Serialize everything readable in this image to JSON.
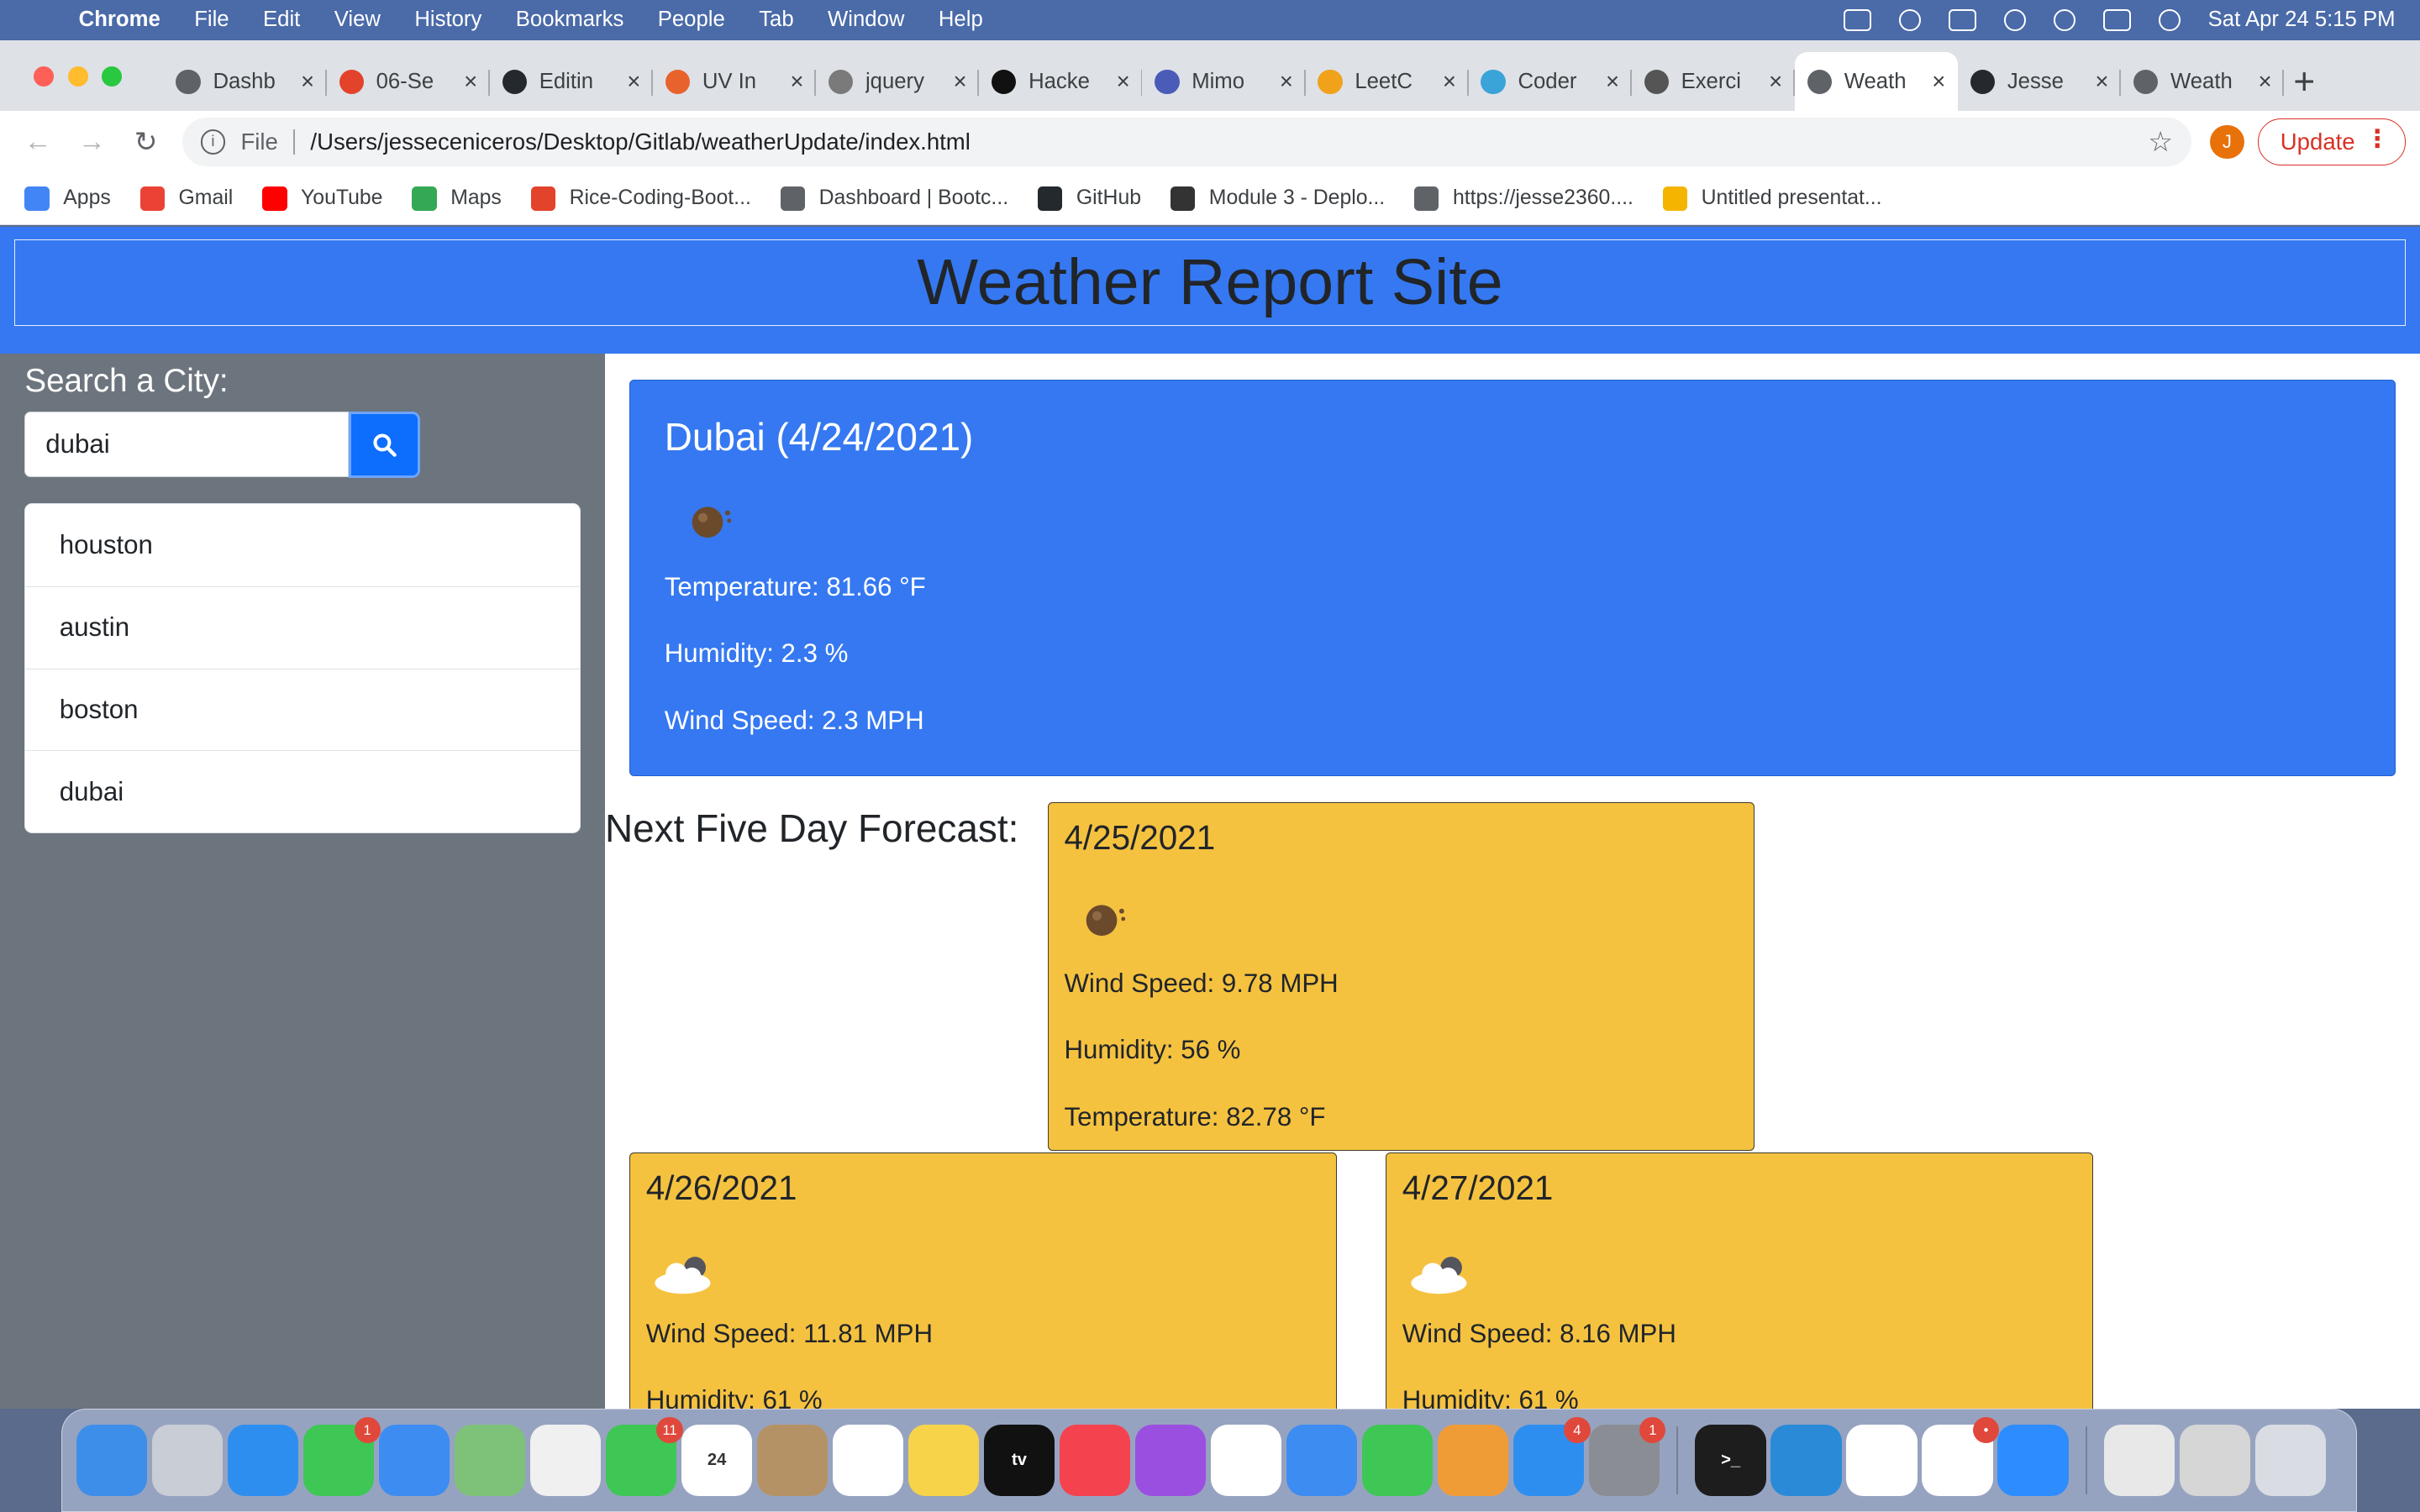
{
  "menubar": {
    "items": [
      "Chrome",
      "File",
      "Edit",
      "View",
      "History",
      "Bookmarks",
      "People",
      "Tab",
      "Window",
      "Help"
    ],
    "clock": "Sat Apr 24  5:15 PM"
  },
  "tabs": [
    {
      "title": "Dashb",
      "color": "#5f6368"
    },
    {
      "title": "06-Se",
      "color": "#e2432a"
    },
    {
      "title": "Editin",
      "color": "#24292e"
    },
    {
      "title": "UV In",
      "color": "#e8622c"
    },
    {
      "title": "jquery",
      "color": "#7a7a7a"
    },
    {
      "title": "Hacke",
      "color": "#111111"
    },
    {
      "title": "Mimo",
      "color": "#4b5bb8"
    },
    {
      "title": "LeetC",
      "color": "#f0a21b"
    },
    {
      "title": "Coder",
      "color": "#3aa3d8"
    },
    {
      "title": "Exerci",
      "color": "#555555"
    },
    {
      "title": "Weath",
      "color": "#5f6368"
    },
    {
      "title": "Jesse",
      "color": "#24292e"
    },
    {
      "title": "Weath",
      "color": "#5f6368"
    }
  ],
  "toolbar": {
    "file_label": "File",
    "url": "/Users/jesseceniceros/Desktop/Gitlab/weatherUpdate/index.html",
    "profile_initial": "J",
    "update_label": "Update"
  },
  "bookmarks": [
    {
      "label": "Apps",
      "color": "#4285f4"
    },
    {
      "label": "Gmail",
      "color": "#ea4335"
    },
    {
      "label": "YouTube",
      "color": "#ff0000"
    },
    {
      "label": "Maps",
      "color": "#34a853"
    },
    {
      "label": "Rice-Coding-Boot...",
      "color": "#e2432a"
    },
    {
      "label": "Dashboard | Bootc...",
      "color": "#5f6368"
    },
    {
      "label": "GitHub",
      "color": "#24292e"
    },
    {
      "label": "Module 3 - Deplo...",
      "color": "#333333"
    },
    {
      "label": "https://jesse2360....",
      "color": "#5f6368"
    },
    {
      "label": "Untitled presentat...",
      "color": "#f4b400"
    }
  ],
  "site": {
    "title": "Weather Report Site",
    "search_heading": "Search a City:",
    "search_value": "dubai",
    "history": [
      "houston",
      "austin",
      "boston",
      "dubai"
    ],
    "today": {
      "heading": "Dubai (4/24/2021)",
      "temperature": "Temperature: 81.66 °F",
      "humidity": "Humidity: 2.3 %",
      "wind": "Wind Speed: 2.3 MPH"
    },
    "forecast_title": "Next Five Day Forecast:",
    "forecast": [
      {
        "date": "4/25/2021",
        "icon": "dust-icon",
        "wind": "Wind Speed: 9.78 MPH",
        "humidity": "Humidity: 56 %",
        "temperature": "Temperature: 82.78 °F"
      },
      {
        "date": "4/26/2021",
        "icon": "partly-cloudy-icon",
        "wind": "Wind Speed: 11.81 MPH",
        "humidity": "Humidity: 61 %"
      },
      {
        "date": "4/27/2021",
        "icon": "partly-cloudy-icon",
        "wind": "Wind Speed: 8.16 MPH",
        "humidity": "Humidity: 61 %"
      }
    ]
  },
  "dock": {
    "apps": [
      {
        "name": "finder",
        "color": "#3d8ee8",
        "label": ""
      },
      {
        "name": "launchpad",
        "color": "#c9cdd6",
        "label": ""
      },
      {
        "name": "safari",
        "color": "#2e8ef0",
        "label": ""
      },
      {
        "name": "messages",
        "color": "#3ec755",
        "label": "",
        "badge": "1"
      },
      {
        "name": "mail",
        "color": "#3d8cf2",
        "label": ""
      },
      {
        "name": "maps",
        "color": "#7ec27a",
        "label": ""
      },
      {
        "name": "photos",
        "color": "#f0f0f0",
        "label": ""
      },
      {
        "name": "facetime",
        "color": "#3ec755",
        "label": "",
        "badge": "11"
      },
      {
        "name": "calendar",
        "color": "#ffffff",
        "label": "24"
      },
      {
        "name": "contacts",
        "color": "#b59266",
        "label": ""
      },
      {
        "name": "reminders",
        "color": "#ffffff",
        "label": ""
      },
      {
        "name": "notes",
        "color": "#f7d34a",
        "label": ""
      },
      {
        "name": "tv",
        "color": "#111111",
        "label": "tv"
      },
      {
        "name": "music",
        "color": "#f5424f",
        "label": ""
      },
      {
        "name": "podcasts",
        "color": "#9b4fe0",
        "label": ""
      },
      {
        "name": "news",
        "color": "#ffffff",
        "label": ""
      },
      {
        "name": "keynote",
        "color": "#3d8cf2",
        "label": ""
      },
      {
        "name": "numbers",
        "color": "#3ec755",
        "label": ""
      },
      {
        "name": "pages",
        "color": "#f09c36",
        "label": ""
      },
      {
        "name": "app-store",
        "color": "#2e8ef0",
        "label": "",
        "badge": "4"
      },
      {
        "name": "system-preferences",
        "color": "#8a8d93",
        "label": "",
        "badge": "1"
      }
    ],
    "apps2": [
      {
        "name": "terminal",
        "color": "#1d1d1d",
        "label": ">_"
      },
      {
        "name": "vscode",
        "color": "#2a8ad8",
        "label": ""
      },
      {
        "name": "chrome",
        "color": "#ffffff",
        "label": ""
      },
      {
        "name": "slack",
        "color": "#ffffff",
        "label": "",
        "badge": "•"
      },
      {
        "name": "zoom",
        "color": "#2d8cff",
        "label": ""
      }
    ],
    "apps3": [
      {
        "name": "archive",
        "color": "#e8e8e8",
        "label": ""
      },
      {
        "name": "document",
        "color": "#d6d6d6",
        "label": ""
      },
      {
        "name": "trash",
        "color": "#d9dde3",
        "label": ""
      }
    ]
  }
}
